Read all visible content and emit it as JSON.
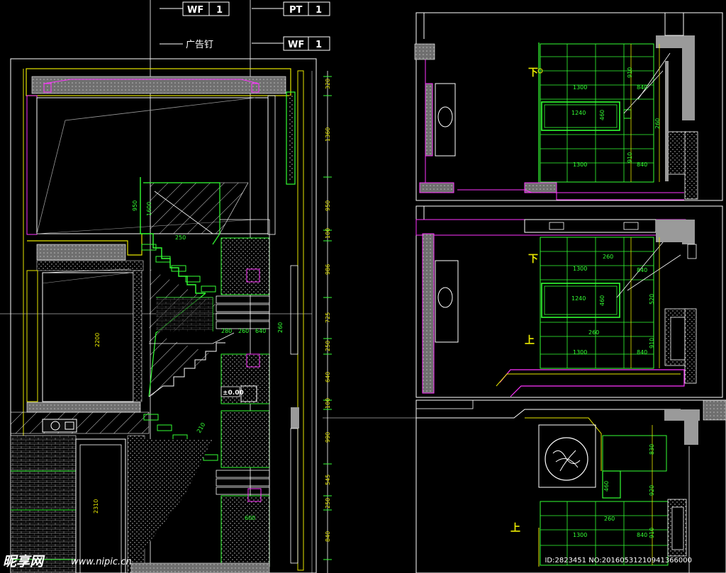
{
  "tags": {
    "tag1": {
      "code": "WF",
      "num": "1"
    },
    "tag2": {
      "code": "PT",
      "num": "1"
    },
    "tag3": {
      "code": "WF",
      "num": "1"
    },
    "nail_label": "广告钉"
  },
  "left_dims": [
    "320",
    "1360",
    "950",
    "100",
    "986",
    "725",
    "250",
    "640",
    "100",
    "990",
    "545",
    "250",
    "840"
  ],
  "left_inner_dims": {
    "d2200": "2200",
    "d2310": "2310",
    "d950": "950",
    "d1600": "1600",
    "d250": "250",
    "d280": "280",
    "d260": "260",
    "d640": "640",
    "d260b": "260",
    "d600": "600",
    "d210": "210",
    "elev": "±0.00"
  },
  "right_top": {
    "down": "下",
    "d1300a": "1300",
    "d1240": "1240",
    "d1300b": "1300",
    "d840a": "840",
    "d840b": "840",
    "d910a": "910",
    "d910b": "910",
    "d460": "460",
    "d260": "260"
  },
  "right_mid": {
    "down": "下",
    "up": "上",
    "d260a": "260",
    "d1300a": "1300",
    "d1240": "1240",
    "d260b": "260",
    "d1300b": "1300",
    "d840a": "840",
    "d840b": "840",
    "d460": "460",
    "d910": "910",
    "d520": "520"
  },
  "right_bot": {
    "up": "上",
    "d1300": "1300",
    "d260": "260",
    "d840": "840",
    "d460": "460",
    "d910": "910",
    "d830": "830",
    "d920": "920"
  },
  "watermark": {
    "brand": "昵享网",
    "url": "www.nipic.cn",
    "id": "ID:2823451 NO:20160531210941366000"
  },
  "colors": {
    "bg": "#000000",
    "green": "#33ff33",
    "yellow": "#e6e600",
    "magenta": "#ff33ff",
    "white": "#ffffff",
    "gray": "#9a9a9a",
    "cyan": "#33ffff"
  }
}
